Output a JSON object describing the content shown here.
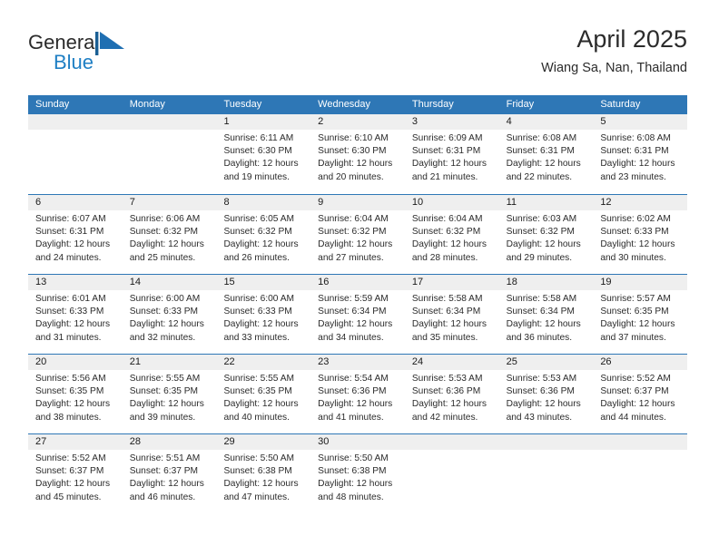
{
  "brand": {
    "name_part1": "General",
    "name_part2": "Blue",
    "accent_color": "#1f7fc4",
    "flag_icon": "blue-flag-logo-icon"
  },
  "header": {
    "title": "April 2025",
    "subtitle": "Wiang Sa, Nan, Thailand"
  },
  "calendar": {
    "header_bg": "#2e77b6",
    "daynum_band_bg": "#efefef",
    "weekday_labels": [
      "Sunday",
      "Monday",
      "Tuesday",
      "Wednesday",
      "Thursday",
      "Friday",
      "Saturday"
    ],
    "weeks": [
      [
        {
          "day": "",
          "sunrise": "",
          "sunset": "",
          "daylight_line1": "",
          "daylight_line2": ""
        },
        {
          "day": "",
          "sunrise": "",
          "sunset": "",
          "daylight_line1": "",
          "daylight_line2": ""
        },
        {
          "day": "1",
          "sunrise": "Sunrise: 6:11 AM",
          "sunset": "Sunset: 6:30 PM",
          "daylight_line1": "Daylight: 12 hours",
          "daylight_line2": "and 19 minutes."
        },
        {
          "day": "2",
          "sunrise": "Sunrise: 6:10 AM",
          "sunset": "Sunset: 6:30 PM",
          "daylight_line1": "Daylight: 12 hours",
          "daylight_line2": "and 20 minutes."
        },
        {
          "day": "3",
          "sunrise": "Sunrise: 6:09 AM",
          "sunset": "Sunset: 6:31 PM",
          "daylight_line1": "Daylight: 12 hours",
          "daylight_line2": "and 21 minutes."
        },
        {
          "day": "4",
          "sunrise": "Sunrise: 6:08 AM",
          "sunset": "Sunset: 6:31 PM",
          "daylight_line1": "Daylight: 12 hours",
          "daylight_line2": "and 22 minutes."
        },
        {
          "day": "5",
          "sunrise": "Sunrise: 6:08 AM",
          "sunset": "Sunset: 6:31 PM",
          "daylight_line1": "Daylight: 12 hours",
          "daylight_line2": "and 23 minutes."
        }
      ],
      [
        {
          "day": "6",
          "sunrise": "Sunrise: 6:07 AM",
          "sunset": "Sunset: 6:31 PM",
          "daylight_line1": "Daylight: 12 hours",
          "daylight_line2": "and 24 minutes."
        },
        {
          "day": "7",
          "sunrise": "Sunrise: 6:06 AM",
          "sunset": "Sunset: 6:32 PM",
          "daylight_line1": "Daylight: 12 hours",
          "daylight_line2": "and 25 minutes."
        },
        {
          "day": "8",
          "sunrise": "Sunrise: 6:05 AM",
          "sunset": "Sunset: 6:32 PM",
          "daylight_line1": "Daylight: 12 hours",
          "daylight_line2": "and 26 minutes."
        },
        {
          "day": "9",
          "sunrise": "Sunrise: 6:04 AM",
          "sunset": "Sunset: 6:32 PM",
          "daylight_line1": "Daylight: 12 hours",
          "daylight_line2": "and 27 minutes."
        },
        {
          "day": "10",
          "sunrise": "Sunrise: 6:04 AM",
          "sunset": "Sunset: 6:32 PM",
          "daylight_line1": "Daylight: 12 hours",
          "daylight_line2": "and 28 minutes."
        },
        {
          "day": "11",
          "sunrise": "Sunrise: 6:03 AM",
          "sunset": "Sunset: 6:32 PM",
          "daylight_line1": "Daylight: 12 hours",
          "daylight_line2": "and 29 minutes."
        },
        {
          "day": "12",
          "sunrise": "Sunrise: 6:02 AM",
          "sunset": "Sunset: 6:33 PM",
          "daylight_line1": "Daylight: 12 hours",
          "daylight_line2": "and 30 minutes."
        }
      ],
      [
        {
          "day": "13",
          "sunrise": "Sunrise: 6:01 AM",
          "sunset": "Sunset: 6:33 PM",
          "daylight_line1": "Daylight: 12 hours",
          "daylight_line2": "and 31 minutes."
        },
        {
          "day": "14",
          "sunrise": "Sunrise: 6:00 AM",
          "sunset": "Sunset: 6:33 PM",
          "daylight_line1": "Daylight: 12 hours",
          "daylight_line2": "and 32 minutes."
        },
        {
          "day": "15",
          "sunrise": "Sunrise: 6:00 AM",
          "sunset": "Sunset: 6:33 PM",
          "daylight_line1": "Daylight: 12 hours",
          "daylight_line2": "and 33 minutes."
        },
        {
          "day": "16",
          "sunrise": "Sunrise: 5:59 AM",
          "sunset": "Sunset: 6:34 PM",
          "daylight_line1": "Daylight: 12 hours",
          "daylight_line2": "and 34 minutes."
        },
        {
          "day": "17",
          "sunrise": "Sunrise: 5:58 AM",
          "sunset": "Sunset: 6:34 PM",
          "daylight_line1": "Daylight: 12 hours",
          "daylight_line2": "and 35 minutes."
        },
        {
          "day": "18",
          "sunrise": "Sunrise: 5:58 AM",
          "sunset": "Sunset: 6:34 PM",
          "daylight_line1": "Daylight: 12 hours",
          "daylight_line2": "and 36 minutes."
        },
        {
          "day": "19",
          "sunrise": "Sunrise: 5:57 AM",
          "sunset": "Sunset: 6:35 PM",
          "daylight_line1": "Daylight: 12 hours",
          "daylight_line2": "and 37 minutes."
        }
      ],
      [
        {
          "day": "20",
          "sunrise": "Sunrise: 5:56 AM",
          "sunset": "Sunset: 6:35 PM",
          "daylight_line1": "Daylight: 12 hours",
          "daylight_line2": "and 38 minutes."
        },
        {
          "day": "21",
          "sunrise": "Sunrise: 5:55 AM",
          "sunset": "Sunset: 6:35 PM",
          "daylight_line1": "Daylight: 12 hours",
          "daylight_line2": "and 39 minutes."
        },
        {
          "day": "22",
          "sunrise": "Sunrise: 5:55 AM",
          "sunset": "Sunset: 6:35 PM",
          "daylight_line1": "Daylight: 12 hours",
          "daylight_line2": "and 40 minutes."
        },
        {
          "day": "23",
          "sunrise": "Sunrise: 5:54 AM",
          "sunset": "Sunset: 6:36 PM",
          "daylight_line1": "Daylight: 12 hours",
          "daylight_line2": "and 41 minutes."
        },
        {
          "day": "24",
          "sunrise": "Sunrise: 5:53 AM",
          "sunset": "Sunset: 6:36 PM",
          "daylight_line1": "Daylight: 12 hours",
          "daylight_line2": "and 42 minutes."
        },
        {
          "day": "25",
          "sunrise": "Sunrise: 5:53 AM",
          "sunset": "Sunset: 6:36 PM",
          "daylight_line1": "Daylight: 12 hours",
          "daylight_line2": "and 43 minutes."
        },
        {
          "day": "26",
          "sunrise": "Sunrise: 5:52 AM",
          "sunset": "Sunset: 6:37 PM",
          "daylight_line1": "Daylight: 12 hours",
          "daylight_line2": "and 44 minutes."
        }
      ],
      [
        {
          "day": "27",
          "sunrise": "Sunrise: 5:52 AM",
          "sunset": "Sunset: 6:37 PM",
          "daylight_line1": "Daylight: 12 hours",
          "daylight_line2": "and 45 minutes."
        },
        {
          "day": "28",
          "sunrise": "Sunrise: 5:51 AM",
          "sunset": "Sunset: 6:37 PM",
          "daylight_line1": "Daylight: 12 hours",
          "daylight_line2": "and 46 minutes."
        },
        {
          "day": "29",
          "sunrise": "Sunrise: 5:50 AM",
          "sunset": "Sunset: 6:38 PM",
          "daylight_line1": "Daylight: 12 hours",
          "daylight_line2": "and 47 minutes."
        },
        {
          "day": "30",
          "sunrise": "Sunrise: 5:50 AM",
          "sunset": "Sunset: 6:38 PM",
          "daylight_line1": "Daylight: 12 hours",
          "daylight_line2": "and 48 minutes."
        },
        {
          "day": "",
          "sunrise": "",
          "sunset": "",
          "daylight_line1": "",
          "daylight_line2": ""
        },
        {
          "day": "",
          "sunrise": "",
          "sunset": "",
          "daylight_line1": "",
          "daylight_line2": ""
        },
        {
          "day": "",
          "sunrise": "",
          "sunset": "",
          "daylight_line1": "",
          "daylight_line2": ""
        }
      ]
    ]
  }
}
